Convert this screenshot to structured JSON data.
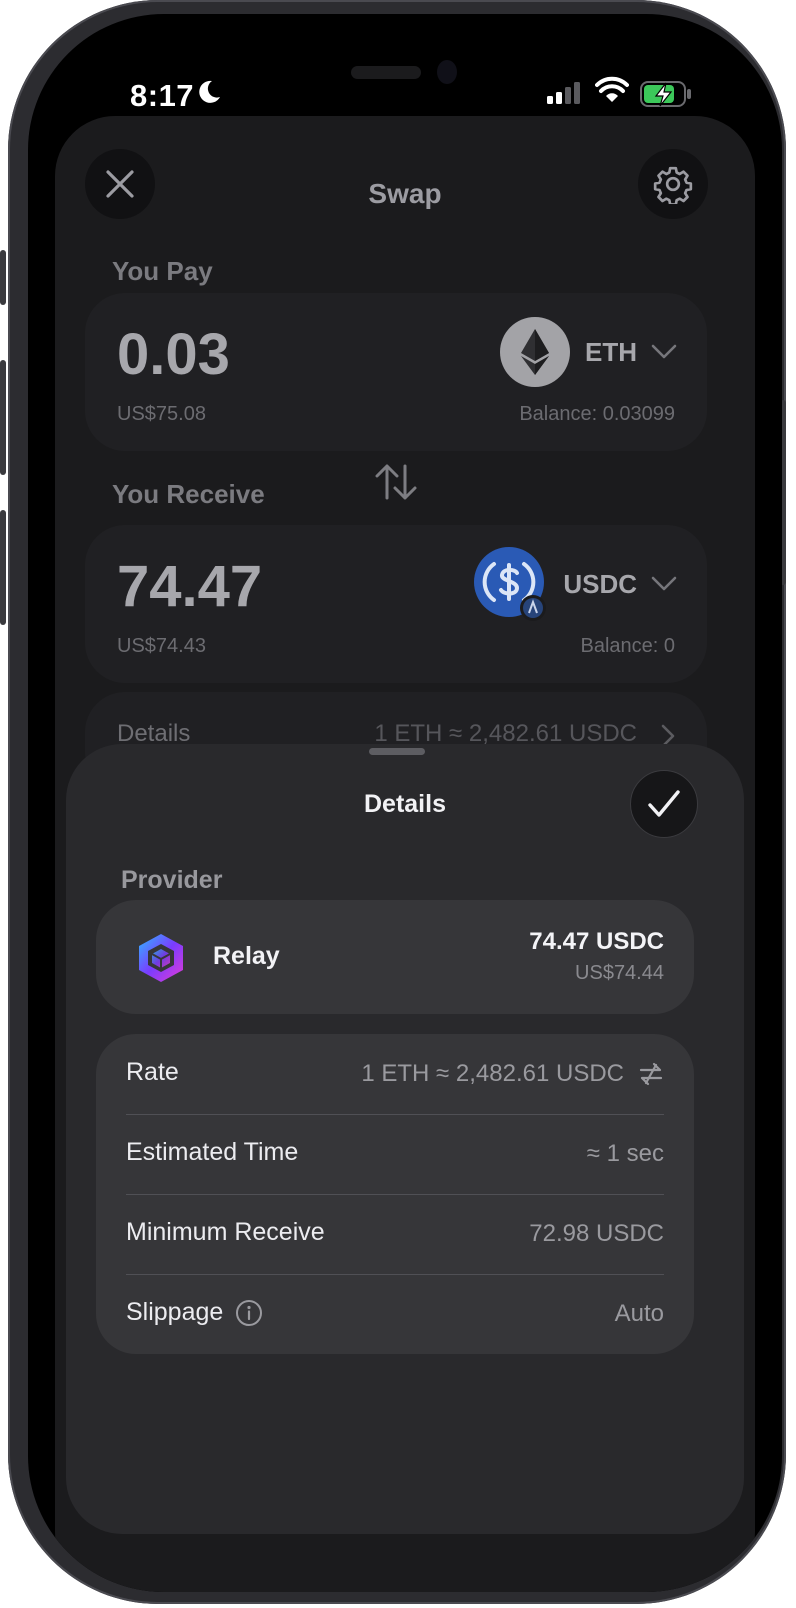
{
  "status_bar": {
    "time": "8:17"
  },
  "swap": {
    "title": "Swap",
    "pay": {
      "label": "You Pay",
      "amount": "0.03",
      "usd": "US$75.08",
      "token": "ETH",
      "balance": "Balance: 0.03099"
    },
    "receive": {
      "label": "You Receive",
      "amount": "74.47",
      "usd": "US$74.43",
      "token": "USDC",
      "balance": "Balance: 0"
    },
    "details_row": {
      "label": "Details",
      "rate": "1 ETH ≈ 2,482.61 USDC"
    }
  },
  "details_sheet": {
    "title": "Details",
    "provider_label": "Provider",
    "provider": {
      "name": "Relay",
      "amount": "74.47 USDC",
      "usd": "US$74.44"
    },
    "rows": [
      {
        "key": "Rate",
        "value": "1 ETH ≈ 2,482.61 USDC"
      },
      {
        "key": "Estimated Time",
        "value": "≈ 1 sec"
      },
      {
        "key": "Minimum Receive",
        "value": "72.98 USDC"
      },
      {
        "key": "Slippage",
        "value": "Auto"
      }
    ]
  },
  "colors": {
    "background": "#1b1b1d",
    "sheet": "#29292c",
    "card": "#363639",
    "usdc_blue": "#2a5ab5",
    "relay_gradient": [
      "#2fb8ff",
      "#7a3cff",
      "#e23bd6"
    ]
  },
  "icons": [
    "close-icon",
    "gear-icon",
    "eth-icon",
    "usdc-icon",
    "chevron-down-icon",
    "swap-arrows-icon",
    "chevron-right-icon",
    "checkmark-icon",
    "relay-logo",
    "swap-rate-icon",
    "info-icon"
  ]
}
